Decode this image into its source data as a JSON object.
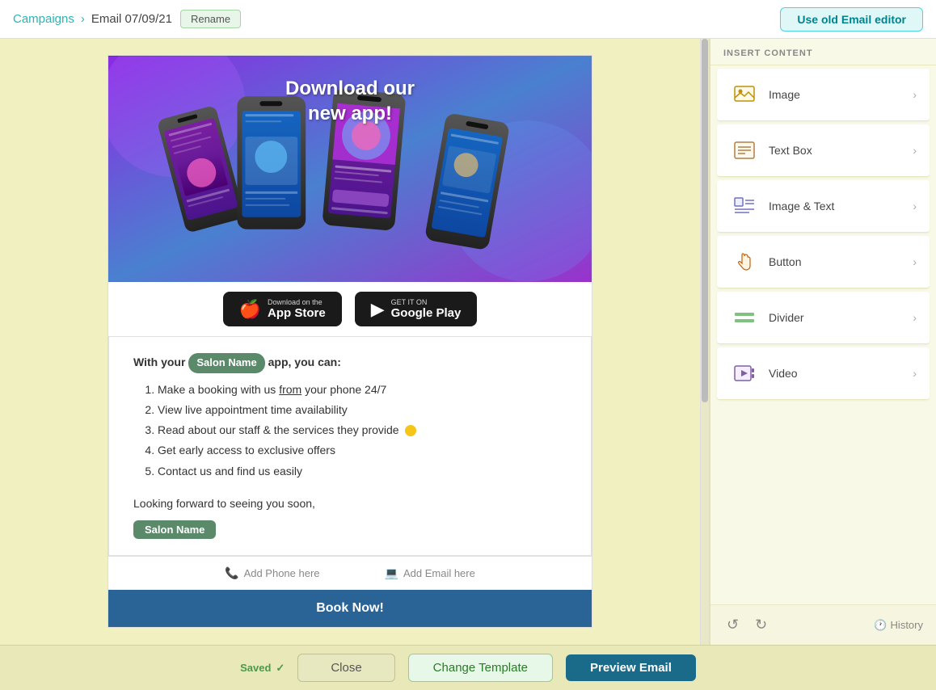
{
  "header": {
    "breadcrumb_campaigns": "Campaigns",
    "separator": "›",
    "email_title": "Email 07/09/21",
    "rename_label": "Rename",
    "use_old_editor_label": "Use old Email editor"
  },
  "canvas": {
    "app_section": {
      "title_line1": "Download our",
      "title_line2": "new app!"
    },
    "store_buttons": {
      "appstore_top": "Download on the",
      "appstore_main": "App Store",
      "googleplay_top": "GET IT ON",
      "googleplay_main": "Google Play"
    },
    "text_content": {
      "intro": "With your ",
      "salon_name": "Salon Name",
      "intro_suffix": " app, you can:",
      "list_items": [
        {
          "text": "Make a booking with us ",
          "link": "from",
          "suffix": " your phone 24/7"
        },
        {
          "text": "View live appointment time availability"
        },
        {
          "text": "Read about our staff & the services they provide"
        },
        {
          "text": "Get early access to exclusive offers"
        },
        {
          "text": "Contact us and find us easily"
        }
      ],
      "looking_forward": "Looking forward to seeing you soon,",
      "salon_name_footer": "Salon Name"
    },
    "contact": {
      "phone_label": "Add Phone here",
      "email_label": "Add Email here"
    },
    "book_now": "Book Now!"
  },
  "sidebar": {
    "header": "INSERT CONTENT",
    "items": [
      {
        "id": "image",
        "label": "Image",
        "icon": "image-icon"
      },
      {
        "id": "textbox",
        "label": "Text Box",
        "icon": "textbox-icon"
      },
      {
        "id": "imagetext",
        "label": "Image & Text",
        "icon": "imagetext-icon"
      },
      {
        "id": "button",
        "label": "Button",
        "icon": "button-icon"
      },
      {
        "id": "divider",
        "label": "Divider",
        "icon": "divider-icon"
      },
      {
        "id": "video",
        "label": "Video",
        "icon": "video-icon"
      }
    ],
    "undo_label": "↺",
    "redo_label": "↻",
    "history_label": "History",
    "history_icon": "history-icon"
  },
  "bottom_toolbar": {
    "saved_label": "Saved",
    "close_label": "Close",
    "change_template_label": "Change Template",
    "preview_label": "Preview Email"
  }
}
